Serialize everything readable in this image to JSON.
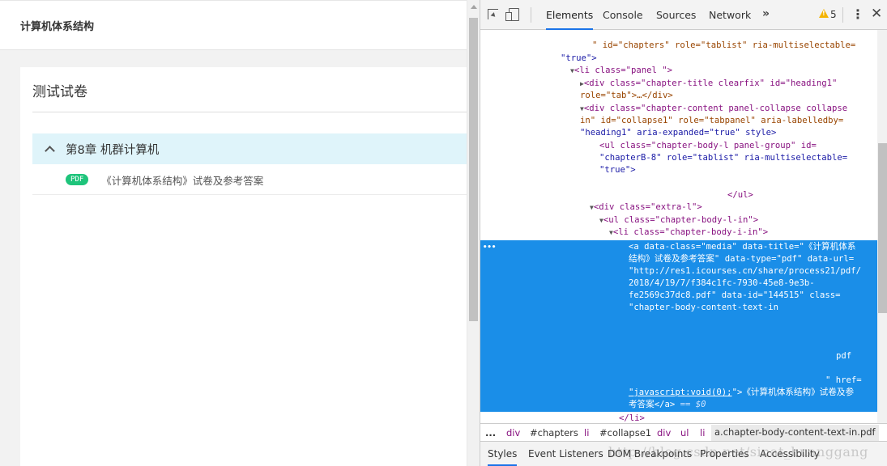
{
  "page": {
    "header_title": "计算机体系结构",
    "exam_title": "测试试卷",
    "chapter_title": "第8章 机群计算机",
    "file_badge": "PDF",
    "file_title": "《计算机体系结构》试卷及参考答案"
  },
  "devtools": {
    "tabs": [
      "Elements",
      "Console",
      "Sources",
      "Network"
    ],
    "more": "»",
    "warning_count": "5",
    "kebab": "⋮",
    "close": "✕",
    "dom": {
      "l1_val": "\" id=\"chapters\" role=\"tablist\" ria-multiselectable=",
      "l2_val": "\"true\">",
      "l3": "<li class=\"panel \">",
      "l4": "<div class=\"chapter-title clearfix\" id=\"heading1\"",
      "l5": "role=\"tab\">…</div>",
      "l6": "<div class=\"chapter-content panel-collapse collapse",
      "l7": "in\" id=\"collapse1\" role=\"tabpanel\" aria-labelledby=",
      "l8": "\"heading1\" aria-expanded=\"true\" style>",
      "l9": "<ul class=\"chapter-body-l panel-group\" id=",
      "l10": "\"chapterB-8\" role=\"tablist\" ria-multiselectable=",
      "l11": "\"true\">",
      "l12": "</ul>",
      "l13": "<div class=\"extra-l\">",
      "l14": "<ul class=\"chapter-body-l-in\">",
      "l15": "<li class=\"chapter-body-i-in\">",
      "s1": "<a data-class=\"media\" data-title=\"《计算机体系",
      "s2": "结构》试卷及参考答案\" data-type=\"pdf\" data-url=",
      "s3": "\"http://res1.icourses.cn/share/process21/pdf/",
      "s4": "2018/4/19/7/f384c1fc-7930-45e8-9e3b-",
      "s5": "fe2569c37dc8.pdf\" data-id=\"144515\" class=",
      "s6": "\"chapter-body-content-text-in",
      "s7": "pdf",
      "s8": "\" href=",
      "s9_link": "\"javascript:void(0);",
      "s9_rest": "\">《计算机体系结构》试卷及参",
      "s10": "考答案</a>",
      "s10_eq": " == $0",
      "l16": "</li>"
    },
    "breadcrumb": [
      "...",
      "div",
      "#chapters",
      "li",
      "#collapse1",
      "div",
      "ul",
      "li",
      "a.chapter-body-content-text-in.pdf"
    ],
    "lower_tabs": [
      "Styles",
      "Event Listeners",
      "DOM Breakpoints",
      "Properties",
      "Accessibility"
    ],
    "watermark": "http://blog.csdn.net/sinat_huanggang"
  }
}
